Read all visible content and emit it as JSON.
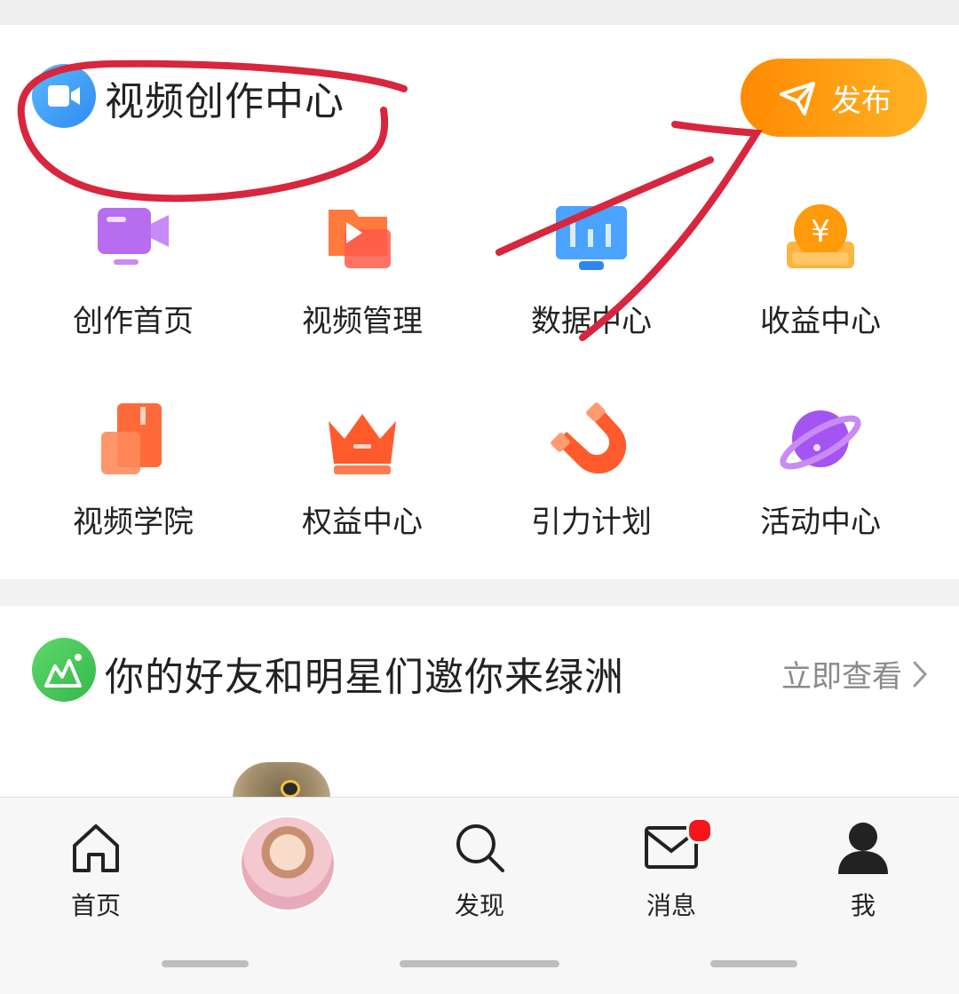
{
  "creator": {
    "title": "视频创作中心",
    "publish_label": "发布",
    "grid": [
      {
        "label": "创作首页",
        "icon": "creation-home-icon"
      },
      {
        "label": "视频管理",
        "icon": "video-management-icon"
      },
      {
        "label": "数据中心",
        "icon": "data-center-icon"
      },
      {
        "label": "收益中心",
        "icon": "earnings-center-icon"
      },
      {
        "label": "视频学院",
        "icon": "video-academy-icon"
      },
      {
        "label": "权益中心",
        "icon": "benefits-center-icon"
      },
      {
        "label": "引力计划",
        "icon": "gravity-plan-icon"
      },
      {
        "label": "活动中心",
        "icon": "activity-center-icon"
      }
    ]
  },
  "oasis": {
    "title": "你的好友和明星们邀你来绿洲",
    "action": "立即查看"
  },
  "tabbar": {
    "tabs": [
      {
        "label": "首页",
        "icon": "home-icon"
      },
      {
        "label": "",
        "icon": "avatar"
      },
      {
        "label": "发现",
        "icon": "discover-icon"
      },
      {
        "label": "消息",
        "icon": "message-icon"
      },
      {
        "label": "我",
        "icon": "profile-icon"
      }
    ],
    "accent_badge": "#f5161c"
  },
  "colors": {
    "publish_start": "#ff8a00",
    "publish_end": "#ffb224",
    "annotation_red": "#d7263d"
  }
}
